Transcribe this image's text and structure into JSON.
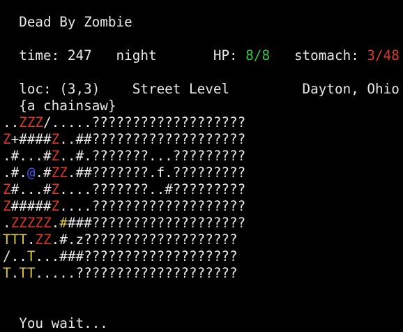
{
  "game": {
    "title": "Dead By Zombie"
  },
  "status": {
    "time_label": "time:",
    "time_value": "247",
    "phase": "night",
    "hp_label": "HP:",
    "hp_value": "8/8",
    "stomach_label": "stomach:",
    "stomach_value": "3/48",
    "loc_label": "loc:",
    "loc_value": "(3,3)",
    "level": "Street Level",
    "city": "Dayton, Ohio",
    "inventory": "{a chainsaw}"
  },
  "colors": {
    "text": "#e8e8e8",
    "zombie": "#d83a2a",
    "player": "#4a52e8",
    "tree": "#d8c44a",
    "hp": "#33c44a",
    "stomach": "#d83a2a",
    "background": "#000000"
  },
  "legend": {
    "w": "plain terrain/text",
    "r": "zombie",
    "b": "player",
    "y": "tree/vegetation"
  },
  "map": [
    [
      [
        "..",
        "w"
      ],
      [
        "ZZZ",
        "r"
      ],
      [
        "/.....???????????????????",
        "w"
      ]
    ],
    [
      [
        "Z",
        "r"
      ],
      [
        "+####",
        "w"
      ],
      [
        "Z",
        "r"
      ],
      [
        "..##???????????????????",
        "w"
      ]
    ],
    [
      [
        ".#...#",
        "w"
      ],
      [
        "Z",
        "r"
      ],
      [
        "..#.???????...?????????",
        "w"
      ]
    ],
    [
      [
        ".#.",
        "w"
      ],
      [
        "@",
        "b"
      ],
      [
        ".#",
        "w"
      ],
      [
        "ZZ",
        "r"
      ],
      [
        ".##???????.f.?????????",
        "w"
      ]
    ],
    [
      [
        "Z",
        "r"
      ],
      [
        "#...#",
        "w"
      ],
      [
        "Z",
        "r"
      ],
      [
        "....???????..#?????????",
        "w"
      ]
    ],
    [
      [
        "Z",
        "r"
      ],
      [
        "#####",
        "w"
      ],
      [
        "Z",
        "r"
      ],
      [
        "....???????????????????",
        "w"
      ]
    ],
    [
      [
        ".",
        "w"
      ],
      [
        "ZZZZZ",
        "r"
      ],
      [
        ".",
        "w"
      ],
      [
        "#",
        "y"
      ],
      [
        "###???????????????????",
        "w"
      ]
    ],
    [
      [
        "TTT",
        "y"
      ],
      [
        ".",
        "w"
      ],
      [
        "ZZ",
        "r"
      ],
      [
        ".#.z???????????????????",
        "w"
      ]
    ],
    [
      [
        "/..",
        "w"
      ],
      [
        "T",
        "y"
      ],
      [
        "...###???????????????????",
        "w"
      ]
    ],
    [
      [
        "T",
        "y"
      ],
      [
        ".",
        "w"
      ],
      [
        "TT",
        "y"
      ],
      [
        ".....????????????????????",
        "w"
      ]
    ]
  ],
  "message": "You wait..."
}
